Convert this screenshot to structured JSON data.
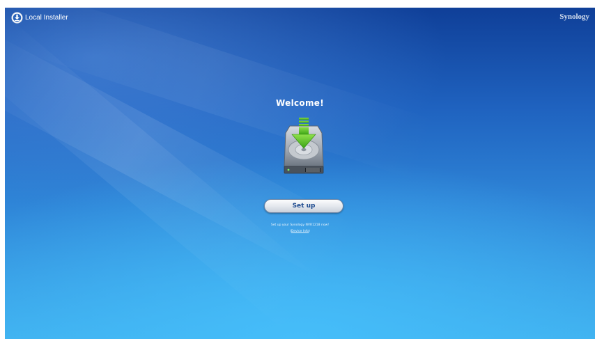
{
  "header": {
    "app_title": "Local Installer",
    "brand": "Synology",
    "icon": "download-icon"
  },
  "main": {
    "welcome": "Welcome!",
    "illustration": "hard-drive-download-icon",
    "setup_label": "Set up",
    "description": "Set up your Synology NVR1218 now!",
    "paren_open": "(",
    "device_info_label": "Device Info",
    "paren_close": ")"
  },
  "colors": {
    "background_top": "#0f3f98",
    "background_bottom": "#3fb0ee",
    "button_text": "#1d4a8f",
    "arrow_green": "#4dbb1f"
  }
}
